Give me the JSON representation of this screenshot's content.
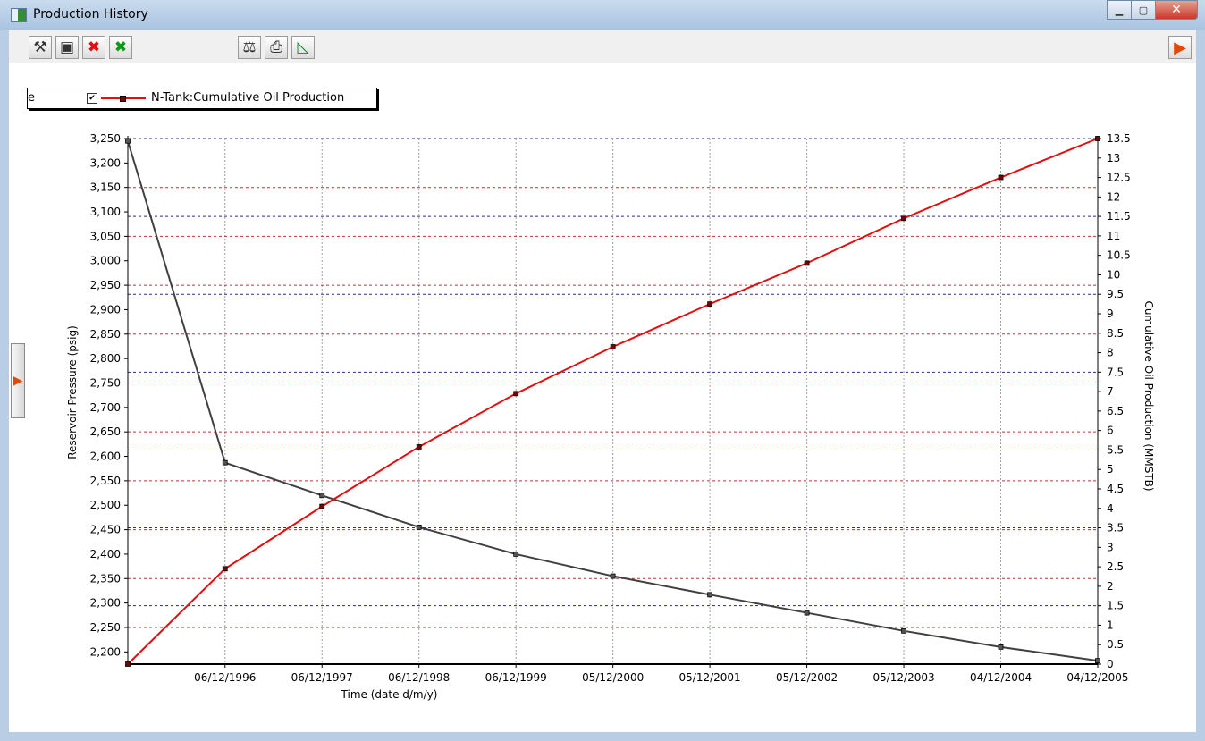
{
  "window": {
    "title": "Production History",
    "minimize_glyph": "▁",
    "maximize_glyph": "▢",
    "close_glyph": "✕"
  },
  "toolbar": {
    "icons": [
      {
        "name": "tools-icon",
        "glyph": "⚒"
      },
      {
        "name": "fit-to-window-icon",
        "glyph": "▣"
      },
      {
        "name": "delete-red-x-icon",
        "glyph": "✖"
      },
      {
        "name": "delete-all-green-x-icon",
        "glyph": "✖"
      },
      {
        "name": "scale-icon",
        "glyph": "⚖"
      },
      {
        "name": "print-icon",
        "glyph": "⎙"
      },
      {
        "name": "triangle-ruler-icon",
        "glyph": "◺"
      }
    ],
    "collapse_glyph": "▶"
  },
  "side_panel": {
    "glyph": "▶"
  },
  "legend": {
    "truncated_fragment": "e",
    "check_glyph": "✔",
    "label": "N-Tank:Cumulative Oil Production"
  },
  "colors": {
    "pressure_line": "#404040",
    "oil_line": "#e01010",
    "grid_red": "#c03030",
    "grid_blue": "#2a2a90",
    "grid_vertical": "#a0a0a0"
  },
  "chart_data": {
    "type": "line",
    "x_label": "Time (date d/m/y)",
    "y_left_label": "Reservoir Pressure (psig)",
    "y_right_label": "Cumulative Oil Production (MMSTB)",
    "x_dates": [
      "1995-12-06",
      "1996-12-06",
      "1997-12-06",
      "1998-12-06",
      "1999-12-06",
      "2000-12-05",
      "2001-12-05",
      "2002-12-05",
      "2003-12-05",
      "2004-12-04",
      "2005-12-04"
    ],
    "x_tick_labels": [
      "06/12/1996",
      "06/12/1997",
      "06/12/1998",
      "06/12/1999",
      "05/12/2000",
      "05/12/2001",
      "05/12/2002",
      "05/12/2003",
      "04/12/2004",
      "04/12/2005"
    ],
    "y_left_ticks": [
      "3,250",
      "3,200",
      "3,150",
      "3,100",
      "3,050",
      "3,000",
      "2,950",
      "2,900",
      "2,850",
      "2,800",
      "2,750",
      "2,700",
      "2,650",
      "2,600",
      "2,550",
      "2,500",
      "2,450",
      "2,400",
      "2,350",
      "2,300",
      "2,250",
      "2,200"
    ],
    "y_right_ticks": [
      "13.5",
      "13",
      "12.5",
      "12",
      "11.5",
      "11",
      "10.5",
      "10",
      "9.5",
      "9",
      "8.5",
      "8",
      "7.5",
      "7",
      "6.5",
      "6",
      "5.5",
      "5",
      "4.5",
      "4",
      "3.5",
      "3",
      "2.5",
      "2",
      "1.5",
      "1",
      "0.5",
      "0"
    ],
    "y_left_range": [
      2175,
      3250
    ],
    "y_right_range": [
      0,
      13.5
    ],
    "grid": true,
    "series": [
      {
        "name": "",
        "axis": "left",
        "values": [
          3245,
          2587,
          2520,
          2455,
          2400,
          2355,
          2317,
          2280,
          2243,
          2210,
          2182
        ]
      },
      {
        "name": "N-Tank:Cumulative Oil Production",
        "axis": "right",
        "values": [
          0,
          2.45,
          4.05,
          5.58,
          6.95,
          8.15,
          9.25,
          10.3,
          11.45,
          12.5,
          13.5
        ]
      }
    ]
  }
}
